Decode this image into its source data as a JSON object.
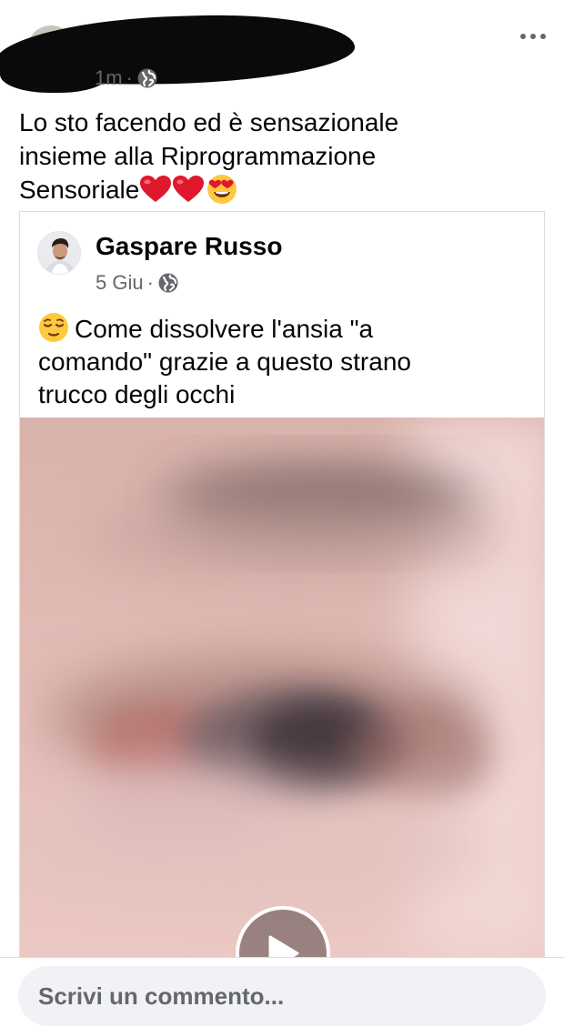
{
  "post": {
    "timestamp": "1m",
    "separator": "·",
    "text_line1": "Lo sto facendo ed è  sensazionale",
    "text_line2": "insieme alla Riprogrammazione",
    "text_line3": "Sensoriale",
    "emojis": [
      "heart-icon",
      "heart-icon",
      "heart-eyes-icon"
    ],
    "more_icon": "more-horizontal-icon",
    "privacy_icon": "globe-icon"
  },
  "shared_post": {
    "author": "Gaspare Russo",
    "date": "5 Giu",
    "separator": "·",
    "privacy_icon": "globe-icon",
    "leading_emoji": "relieved-face-icon",
    "text_line1": "Come dissolvere l'ansia \"a",
    "text_line2": "comando\" grazie a questo strano",
    "text_line3": "trucco degli occhi",
    "media": {
      "type": "video",
      "control_icon": "play-icon"
    }
  },
  "comment": {
    "placeholder": "Scrivi un commento..."
  },
  "colors": {
    "text_primary": "#050505",
    "text_secondary": "#65676b",
    "comment_bg": "#f0f2f5",
    "heart": "#e0182d"
  }
}
